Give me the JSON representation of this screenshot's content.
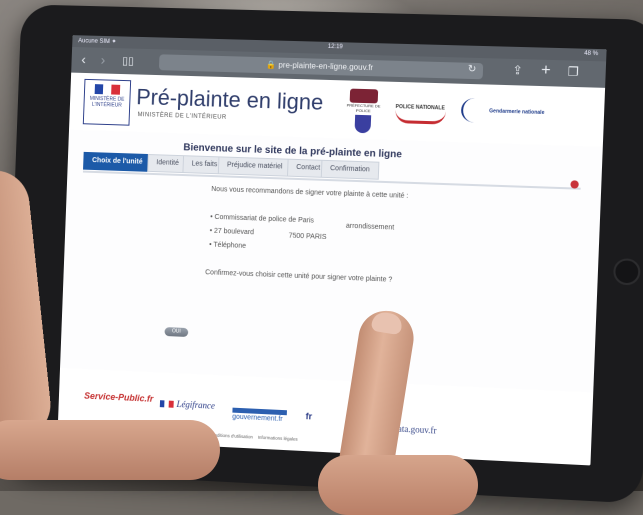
{
  "status_bar": {
    "carrier": "Aucune SIM ✦",
    "time": "12:19",
    "battery": "48 %"
  },
  "browser": {
    "url": "🔒 pre-plainte-en-ligne.gouv.fr"
  },
  "header": {
    "logo_text": "MINISTÈRE DE L'INTÉRIEUR",
    "title": "Pré-plainte en ligne",
    "subtitle": "MINISTÈRE DE L'INTÉRIEUR",
    "partner_police": "PRÉFECTURE DE POLICE",
    "partner_national": "POLICE NATIONALE",
    "partner_gendarmerie": "Gendarmerie nationale"
  },
  "welcome": "Bienvenue sur le site de la pré-plainte en ligne",
  "tabs": [
    {
      "label": "Choix de l'unité",
      "active": true
    },
    {
      "label": "Identité"
    },
    {
      "label": "Les faits"
    },
    {
      "label": "Préjudice matériel"
    },
    {
      "label": "Contact"
    },
    {
      "label": "Confirmation"
    }
  ],
  "content": {
    "recommend": "Nous vous recommandons de signer votre plainte à cette unité :",
    "unit_name": "• Commissariat de police de Paris",
    "unit_arr": "arrondissement",
    "unit_address": "• 27 boulevard",
    "unit_city": "7500  PARIS",
    "unit_phone": "• Téléphone",
    "confirm_question": "Confirmez-vous choisir cette unité pour signer votre plainte ?",
    "oui_button": "OUI"
  },
  "footer": {
    "service_public": "Service-Public.fr",
    "legifrance": "Légifrance",
    "gouvernement": "gouvernement.fr",
    "france": "fr",
    "data": "data.gouv.fr",
    "conditions": "Conditions d'utilisation",
    "infos": "Informations légales"
  }
}
